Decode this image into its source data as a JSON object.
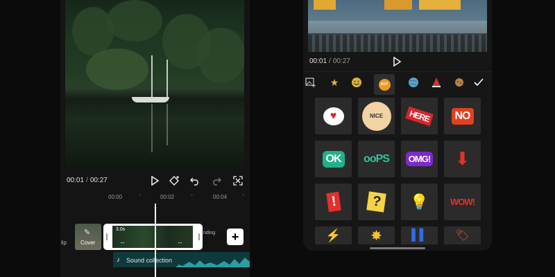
{
  "editor": {
    "time_current": "00:01",
    "time_total": "00:27",
    "ruler_ticks": [
      "00:00",
      "00:02",
      "00:04"
    ],
    "clip_duration": "3.0s",
    "cover_label": "Cover",
    "left_clip_text": "lip",
    "right_clip_text": "nding",
    "add_label": "+",
    "audio_label": "Sound collection"
  },
  "stickers_panel": {
    "time_current": "00:01",
    "time_total": "00:27",
    "categories": [
      "image-add-icon",
      "star-icon",
      "smiley-icon",
      "hot-icon",
      "globe-icon",
      "party-hat-icon",
      "cookie-icon"
    ],
    "selected_category_label": "HOT",
    "confirm": "checkmark-icon",
    "tiles": [
      {
        "name": "heart-bubble-sticker",
        "text": "♥"
      },
      {
        "name": "nice-thumbs-sticker",
        "text": "NICE"
      },
      {
        "name": "here-arrow-sticker",
        "text": "HERE"
      },
      {
        "name": "no-sticker",
        "text": "NO"
      },
      {
        "name": "ok-sticker",
        "text": "OK"
      },
      {
        "name": "oops-sticker",
        "text": "ooPS"
      },
      {
        "name": "omg-sticker",
        "text": "OMG!"
      },
      {
        "name": "down-arrow-sticker",
        "text": "⬇"
      },
      {
        "name": "exclamation-sticker",
        "text": "!"
      },
      {
        "name": "question-sticker",
        "text": "?"
      },
      {
        "name": "light-bulb-sticker",
        "text": "💡"
      },
      {
        "name": "wow-sticker",
        "text": "WOW!"
      },
      {
        "name": "lightning-sticker",
        "text": "⚡"
      },
      {
        "name": "burst-sticker",
        "text": "✸"
      },
      {
        "name": "blue-bars-sticker",
        "text": "▌▌"
      },
      {
        "name": "tag-sticker",
        "text": "🏷"
      }
    ],
    "colors": {
      "accent": "#ff3b2f",
      "tile_bg": "#2b2b2b",
      "panel_bg": "#161616"
    }
  }
}
